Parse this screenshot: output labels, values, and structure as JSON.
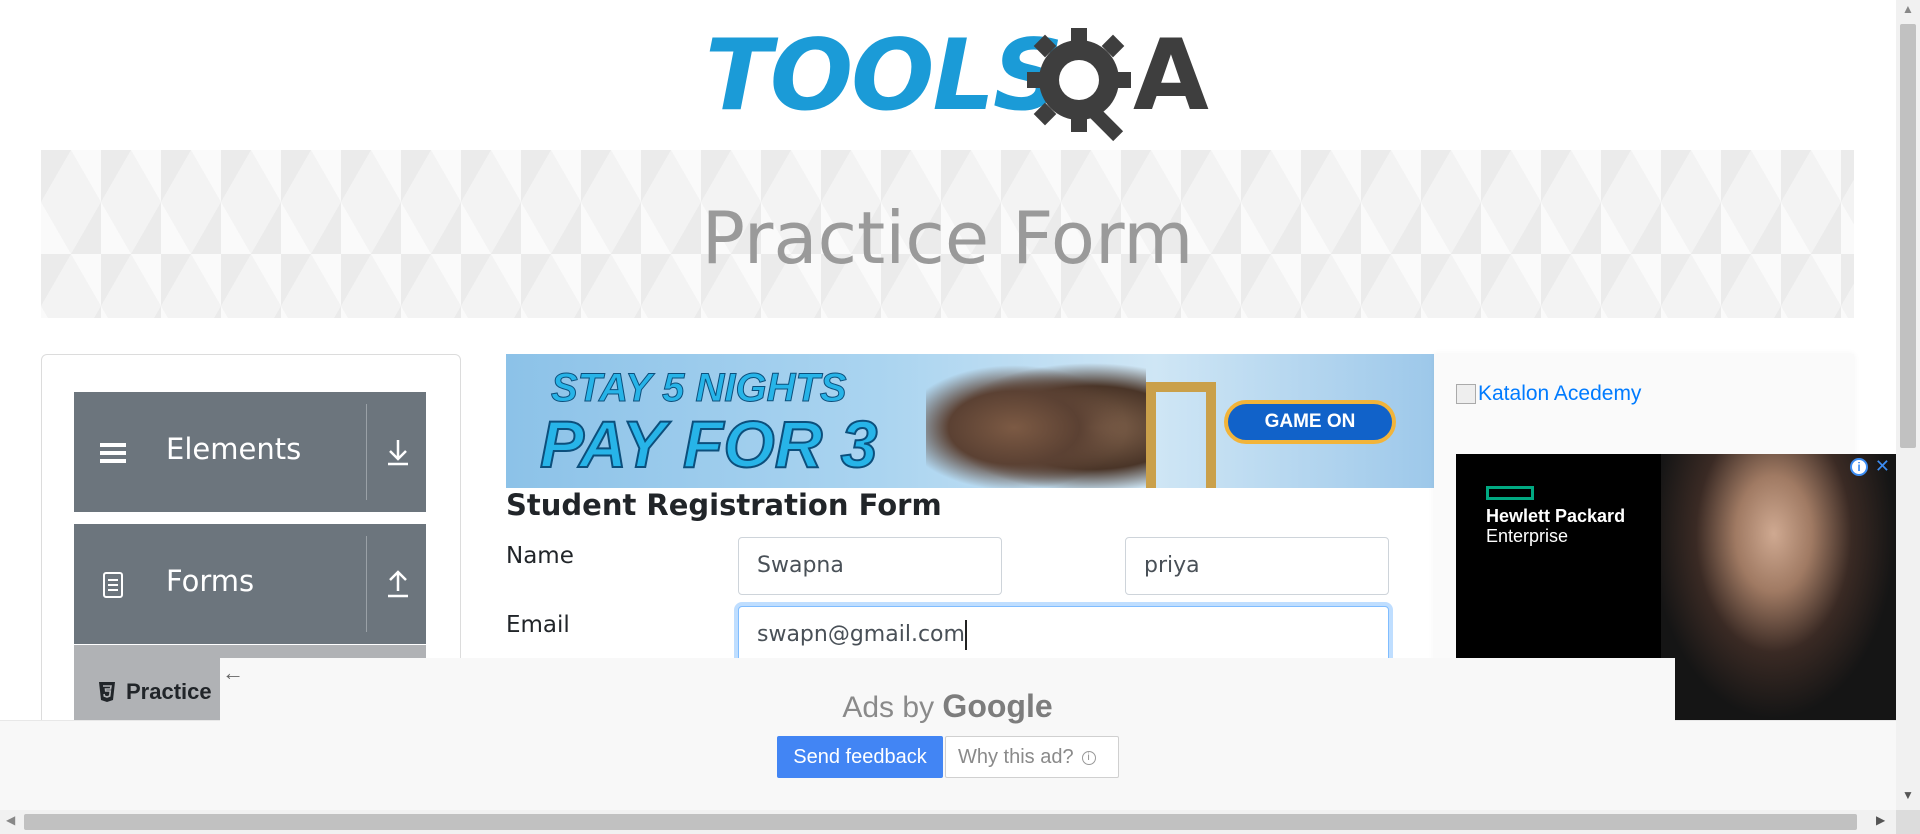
{
  "header": {
    "logo_text": "TOOLS",
    "logo_suffix": "A"
  },
  "banner": {
    "title": "Practice Form"
  },
  "sidebar": {
    "groups": [
      {
        "label": "Elements",
        "icon": "hamburger-icon",
        "toggle_icon": "download-arrow-icon"
      },
      {
        "label": "Forms",
        "icon": "document-icon",
        "toggle_icon": "upload-arrow-icon"
      }
    ],
    "active_item": {
      "label": "Practice",
      "icon": "html5-icon"
    }
  },
  "top_ad": {
    "line1": "STAY 5 NIGHTS",
    "line2": "PAY FOR 3",
    "cta": "GAME ON"
  },
  "form": {
    "title": "Student Registration Form",
    "name_label": "Name",
    "first_name": "Swapna",
    "last_name": "priya",
    "email_label": "Email",
    "email": "swapn@gmail.com"
  },
  "right_ad": {
    "katalon_alt": "Katalon Acedemy",
    "hpe_line1": "Hewlett Packard",
    "hpe_line2": "Enterprise"
  },
  "google_ad": {
    "ads_by": "Ads by",
    "google": "Google",
    "send_feedback": "Send feedback",
    "why_this_ad": "Why this ad?"
  },
  "colors": {
    "accent": "#1b9bd7",
    "sidebar_group": "#6c757d",
    "feedback_button": "#4285f4"
  }
}
